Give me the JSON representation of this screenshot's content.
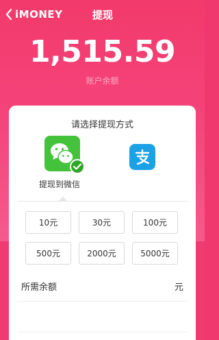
{
  "header": {
    "brand": "iMONEY",
    "title": "提现"
  },
  "balance": {
    "amount": "1,515.59",
    "label": "账户余额"
  },
  "withdraw": {
    "prompt": "请选择提现方式",
    "methods": [
      {
        "label": "提现到微信",
        "icon": "wechat-icon",
        "selected": true
      },
      {
        "label": "",
        "icon": "alipay-icon",
        "selected": false
      }
    ],
    "amount_options": [
      "10元",
      "30元",
      "100元",
      "500元",
      "2000元",
      "5000元"
    ],
    "needed_label": "所需余额",
    "needed_value": "元"
  },
  "colors": {
    "brand_pink": "#f23a6b",
    "wechat_green": "#45c23b",
    "alipay_blue": "#1ba1e6"
  }
}
